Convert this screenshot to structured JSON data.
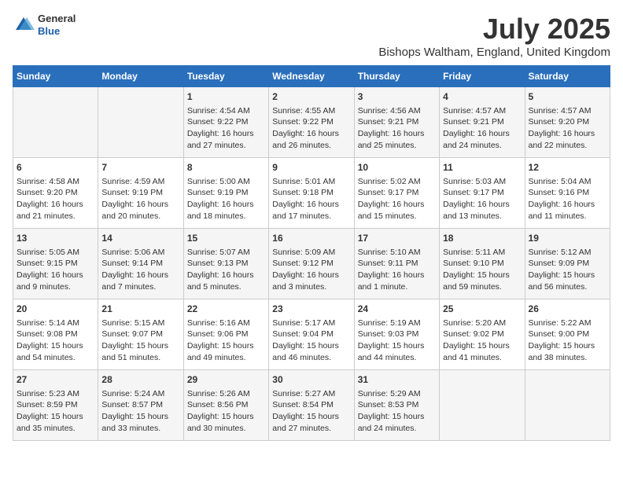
{
  "header": {
    "logo": {
      "general": "General",
      "blue": "Blue"
    },
    "title": "July 2025",
    "location": "Bishops Waltham, England, United Kingdom"
  },
  "days_of_week": [
    "Sunday",
    "Monday",
    "Tuesday",
    "Wednesday",
    "Thursday",
    "Friday",
    "Saturday"
  ],
  "weeks": [
    [
      {
        "day": "",
        "content": ""
      },
      {
        "day": "",
        "content": ""
      },
      {
        "day": "1",
        "content": "Sunrise: 4:54 AM\nSunset: 9:22 PM\nDaylight: 16 hours\nand 27 minutes."
      },
      {
        "day": "2",
        "content": "Sunrise: 4:55 AM\nSunset: 9:22 PM\nDaylight: 16 hours\nand 26 minutes."
      },
      {
        "day": "3",
        "content": "Sunrise: 4:56 AM\nSunset: 9:21 PM\nDaylight: 16 hours\nand 25 minutes."
      },
      {
        "day": "4",
        "content": "Sunrise: 4:57 AM\nSunset: 9:21 PM\nDaylight: 16 hours\nand 24 minutes."
      },
      {
        "day": "5",
        "content": "Sunrise: 4:57 AM\nSunset: 9:20 PM\nDaylight: 16 hours\nand 22 minutes."
      }
    ],
    [
      {
        "day": "6",
        "content": "Sunrise: 4:58 AM\nSunset: 9:20 PM\nDaylight: 16 hours\nand 21 minutes."
      },
      {
        "day": "7",
        "content": "Sunrise: 4:59 AM\nSunset: 9:19 PM\nDaylight: 16 hours\nand 20 minutes."
      },
      {
        "day": "8",
        "content": "Sunrise: 5:00 AM\nSunset: 9:19 PM\nDaylight: 16 hours\nand 18 minutes."
      },
      {
        "day": "9",
        "content": "Sunrise: 5:01 AM\nSunset: 9:18 PM\nDaylight: 16 hours\nand 17 minutes."
      },
      {
        "day": "10",
        "content": "Sunrise: 5:02 AM\nSunset: 9:17 PM\nDaylight: 16 hours\nand 15 minutes."
      },
      {
        "day": "11",
        "content": "Sunrise: 5:03 AM\nSunset: 9:17 PM\nDaylight: 16 hours\nand 13 minutes."
      },
      {
        "day": "12",
        "content": "Sunrise: 5:04 AM\nSunset: 9:16 PM\nDaylight: 16 hours\nand 11 minutes."
      }
    ],
    [
      {
        "day": "13",
        "content": "Sunrise: 5:05 AM\nSunset: 9:15 PM\nDaylight: 16 hours\nand 9 minutes."
      },
      {
        "day": "14",
        "content": "Sunrise: 5:06 AM\nSunset: 9:14 PM\nDaylight: 16 hours\nand 7 minutes."
      },
      {
        "day": "15",
        "content": "Sunrise: 5:07 AM\nSunset: 9:13 PM\nDaylight: 16 hours\nand 5 minutes."
      },
      {
        "day": "16",
        "content": "Sunrise: 5:09 AM\nSunset: 9:12 PM\nDaylight: 16 hours\nand 3 minutes."
      },
      {
        "day": "17",
        "content": "Sunrise: 5:10 AM\nSunset: 9:11 PM\nDaylight: 16 hours\nand 1 minute."
      },
      {
        "day": "18",
        "content": "Sunrise: 5:11 AM\nSunset: 9:10 PM\nDaylight: 15 hours\nand 59 minutes."
      },
      {
        "day": "19",
        "content": "Sunrise: 5:12 AM\nSunset: 9:09 PM\nDaylight: 15 hours\nand 56 minutes."
      }
    ],
    [
      {
        "day": "20",
        "content": "Sunrise: 5:14 AM\nSunset: 9:08 PM\nDaylight: 15 hours\nand 54 minutes."
      },
      {
        "day": "21",
        "content": "Sunrise: 5:15 AM\nSunset: 9:07 PM\nDaylight: 15 hours\nand 51 minutes."
      },
      {
        "day": "22",
        "content": "Sunrise: 5:16 AM\nSunset: 9:06 PM\nDaylight: 15 hours\nand 49 minutes."
      },
      {
        "day": "23",
        "content": "Sunrise: 5:17 AM\nSunset: 9:04 PM\nDaylight: 15 hours\nand 46 minutes."
      },
      {
        "day": "24",
        "content": "Sunrise: 5:19 AM\nSunset: 9:03 PM\nDaylight: 15 hours\nand 44 minutes."
      },
      {
        "day": "25",
        "content": "Sunrise: 5:20 AM\nSunset: 9:02 PM\nDaylight: 15 hours\nand 41 minutes."
      },
      {
        "day": "26",
        "content": "Sunrise: 5:22 AM\nSunset: 9:00 PM\nDaylight: 15 hours\nand 38 minutes."
      }
    ],
    [
      {
        "day": "27",
        "content": "Sunrise: 5:23 AM\nSunset: 8:59 PM\nDaylight: 15 hours\nand 35 minutes."
      },
      {
        "day": "28",
        "content": "Sunrise: 5:24 AM\nSunset: 8:57 PM\nDaylight: 15 hours\nand 33 minutes."
      },
      {
        "day": "29",
        "content": "Sunrise: 5:26 AM\nSunset: 8:56 PM\nDaylight: 15 hours\nand 30 minutes."
      },
      {
        "day": "30",
        "content": "Sunrise: 5:27 AM\nSunset: 8:54 PM\nDaylight: 15 hours\nand 27 minutes."
      },
      {
        "day": "31",
        "content": "Sunrise: 5:29 AM\nSunset: 8:53 PM\nDaylight: 15 hours\nand 24 minutes."
      },
      {
        "day": "",
        "content": ""
      },
      {
        "day": "",
        "content": ""
      }
    ]
  ]
}
